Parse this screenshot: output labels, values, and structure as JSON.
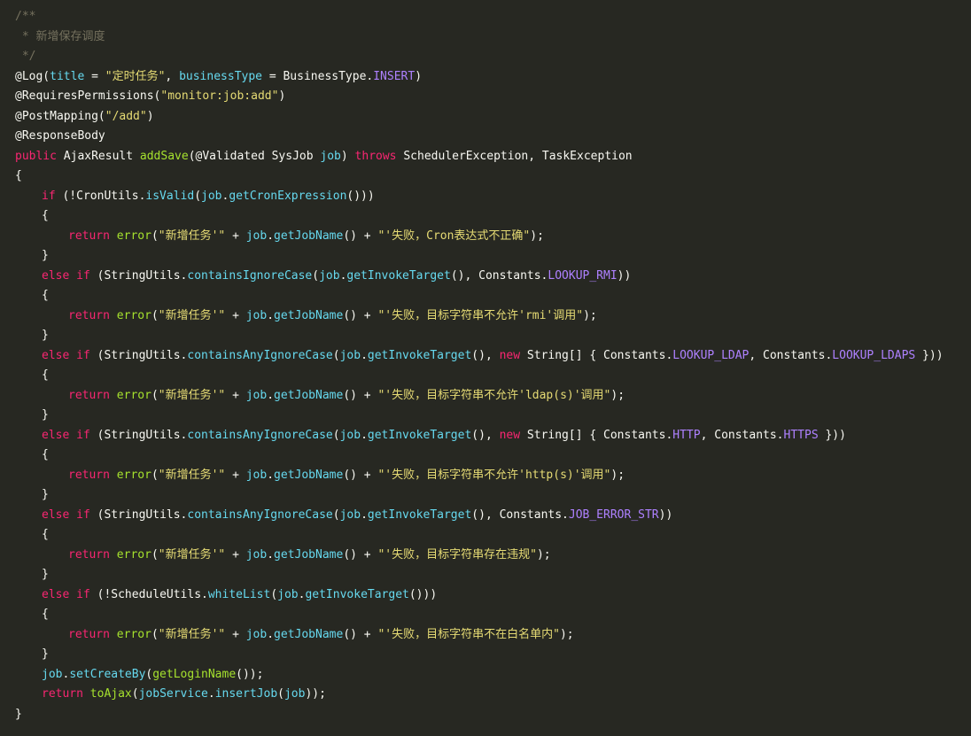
{
  "editor": {
    "theme": {
      "background": "#272822",
      "plain": "#f8f8f2",
      "comment": "#75715e",
      "keyword": "#f92672",
      "string": "#e6db74",
      "function": "#a6e22e",
      "method": "#66d9ef",
      "variable": "#66d9ef",
      "constant": "#ae81ff"
    },
    "lines": [
      {
        "indent": 0,
        "tokens": [
          {
            "t": "c",
            "v": "/**"
          }
        ]
      },
      {
        "indent": 0,
        "tokens": [
          {
            "t": "c",
            "v": " * 新增保存调度"
          }
        ]
      },
      {
        "indent": 0,
        "tokens": [
          {
            "t": "c",
            "v": " */"
          }
        ]
      },
      {
        "indent": 0,
        "tokens": [
          {
            "t": "p",
            "v": "@Log("
          },
          {
            "t": "v",
            "v": "title"
          },
          {
            "t": "p",
            "v": " = "
          },
          {
            "t": "s",
            "v": "\"定时任务\""
          },
          {
            "t": "p",
            "v": ", "
          },
          {
            "t": "v",
            "v": "businessType"
          },
          {
            "t": "p",
            "v": " = BusinessType."
          },
          {
            "t": "cn",
            "v": "INSERT"
          },
          {
            "t": "p",
            "v": ")"
          }
        ]
      },
      {
        "indent": 0,
        "tokens": [
          {
            "t": "p",
            "v": "@RequiresPermissions("
          },
          {
            "t": "s",
            "v": "\"monitor:job:add\""
          },
          {
            "t": "p",
            "v": ")"
          }
        ]
      },
      {
        "indent": 0,
        "tokens": [
          {
            "t": "p",
            "v": "@PostMapping("
          },
          {
            "t": "s",
            "v": "\"/add\""
          },
          {
            "t": "p",
            "v": ")"
          }
        ]
      },
      {
        "indent": 0,
        "tokens": [
          {
            "t": "p",
            "v": "@ResponseBody"
          }
        ]
      },
      {
        "indent": 0,
        "tokens": [
          {
            "t": "k",
            "v": "public"
          },
          {
            "t": "p",
            "v": " AjaxResult "
          },
          {
            "t": "f",
            "v": "addSave"
          },
          {
            "t": "p",
            "v": "(@Validated SysJob "
          },
          {
            "t": "v",
            "v": "job"
          },
          {
            "t": "p",
            "v": ") "
          },
          {
            "t": "k",
            "v": "throws"
          },
          {
            "t": "p",
            "v": " SchedulerException, TaskException"
          }
        ]
      },
      {
        "indent": 0,
        "tokens": [
          {
            "t": "p",
            "v": "{"
          }
        ]
      },
      {
        "indent": 1,
        "tokens": [
          {
            "t": "k",
            "v": "if"
          },
          {
            "t": "p",
            "v": " (!CronUtils."
          },
          {
            "t": "m",
            "v": "isValid"
          },
          {
            "t": "p",
            "v": "("
          },
          {
            "t": "v",
            "v": "job"
          },
          {
            "t": "p",
            "v": "."
          },
          {
            "t": "m",
            "v": "getCronExpression"
          },
          {
            "t": "p",
            "v": "()))"
          }
        ]
      },
      {
        "indent": 1,
        "tokens": [
          {
            "t": "p",
            "v": "{"
          }
        ]
      },
      {
        "indent": 2,
        "tokens": [
          {
            "t": "k",
            "v": "return"
          },
          {
            "t": "p",
            "v": " "
          },
          {
            "t": "f",
            "v": "error"
          },
          {
            "t": "p",
            "v": "("
          },
          {
            "t": "s",
            "v": "\"新增任务'\""
          },
          {
            "t": "p",
            "v": " + "
          },
          {
            "t": "v",
            "v": "job"
          },
          {
            "t": "p",
            "v": "."
          },
          {
            "t": "m",
            "v": "getJobName"
          },
          {
            "t": "p",
            "v": "() + "
          },
          {
            "t": "s",
            "v": "\"'失败，Cron表达式不正确\""
          },
          {
            "t": "p",
            "v": ");"
          }
        ]
      },
      {
        "indent": 1,
        "tokens": [
          {
            "t": "p",
            "v": "}"
          }
        ]
      },
      {
        "indent": 1,
        "tokens": [
          {
            "t": "k",
            "v": "else if"
          },
          {
            "t": "p",
            "v": " (StringUtils."
          },
          {
            "t": "m",
            "v": "containsIgnoreCase"
          },
          {
            "t": "p",
            "v": "("
          },
          {
            "t": "v",
            "v": "job"
          },
          {
            "t": "p",
            "v": "."
          },
          {
            "t": "m",
            "v": "getInvokeTarget"
          },
          {
            "t": "p",
            "v": "(), Constants."
          },
          {
            "t": "cn",
            "v": "LOOKUP_RMI"
          },
          {
            "t": "p",
            "v": "))"
          }
        ]
      },
      {
        "indent": 1,
        "tokens": [
          {
            "t": "p",
            "v": "{"
          }
        ]
      },
      {
        "indent": 2,
        "tokens": [
          {
            "t": "k",
            "v": "return"
          },
          {
            "t": "p",
            "v": " "
          },
          {
            "t": "f",
            "v": "error"
          },
          {
            "t": "p",
            "v": "("
          },
          {
            "t": "s",
            "v": "\"新增任务'\""
          },
          {
            "t": "p",
            "v": " + "
          },
          {
            "t": "v",
            "v": "job"
          },
          {
            "t": "p",
            "v": "."
          },
          {
            "t": "m",
            "v": "getJobName"
          },
          {
            "t": "p",
            "v": "() + "
          },
          {
            "t": "s",
            "v": "\"'失败，目标字符串不允许'rmi'调用\""
          },
          {
            "t": "p",
            "v": ");"
          }
        ]
      },
      {
        "indent": 1,
        "tokens": [
          {
            "t": "p",
            "v": "}"
          }
        ]
      },
      {
        "indent": 1,
        "tokens": [
          {
            "t": "k",
            "v": "else if"
          },
          {
            "t": "p",
            "v": " (StringUtils."
          },
          {
            "t": "m",
            "v": "containsAnyIgnoreCase"
          },
          {
            "t": "p",
            "v": "("
          },
          {
            "t": "v",
            "v": "job"
          },
          {
            "t": "p",
            "v": "."
          },
          {
            "t": "m",
            "v": "getInvokeTarget"
          },
          {
            "t": "p",
            "v": "(), "
          },
          {
            "t": "k",
            "v": "new"
          },
          {
            "t": "p",
            "v": " String[] { Constants."
          },
          {
            "t": "cn",
            "v": "LOOKUP_LDAP"
          },
          {
            "t": "p",
            "v": ", Constants."
          },
          {
            "t": "cn",
            "v": "LOOKUP_LDAPS"
          },
          {
            "t": "p",
            "v": " }))"
          }
        ]
      },
      {
        "indent": 1,
        "tokens": [
          {
            "t": "p",
            "v": "{"
          }
        ]
      },
      {
        "indent": 2,
        "tokens": [
          {
            "t": "k",
            "v": "return"
          },
          {
            "t": "p",
            "v": " "
          },
          {
            "t": "f",
            "v": "error"
          },
          {
            "t": "p",
            "v": "("
          },
          {
            "t": "s",
            "v": "\"新增任务'\""
          },
          {
            "t": "p",
            "v": " + "
          },
          {
            "t": "v",
            "v": "job"
          },
          {
            "t": "p",
            "v": "."
          },
          {
            "t": "m",
            "v": "getJobName"
          },
          {
            "t": "p",
            "v": "() + "
          },
          {
            "t": "s",
            "v": "\"'失败，目标字符串不允许'ldap(s)'调用\""
          },
          {
            "t": "p",
            "v": ");"
          }
        ]
      },
      {
        "indent": 1,
        "tokens": [
          {
            "t": "p",
            "v": "}"
          }
        ]
      },
      {
        "indent": 1,
        "tokens": [
          {
            "t": "k",
            "v": "else if"
          },
          {
            "t": "p",
            "v": " (StringUtils."
          },
          {
            "t": "m",
            "v": "containsAnyIgnoreCase"
          },
          {
            "t": "p",
            "v": "("
          },
          {
            "t": "v",
            "v": "job"
          },
          {
            "t": "p",
            "v": "."
          },
          {
            "t": "m",
            "v": "getInvokeTarget"
          },
          {
            "t": "p",
            "v": "(), "
          },
          {
            "t": "k",
            "v": "new"
          },
          {
            "t": "p",
            "v": " String[] { Constants."
          },
          {
            "t": "cn",
            "v": "HTTP"
          },
          {
            "t": "p",
            "v": ", Constants."
          },
          {
            "t": "cn",
            "v": "HTTPS"
          },
          {
            "t": "p",
            "v": " }))"
          }
        ]
      },
      {
        "indent": 1,
        "tokens": [
          {
            "t": "p",
            "v": "{"
          }
        ]
      },
      {
        "indent": 2,
        "tokens": [
          {
            "t": "k",
            "v": "return"
          },
          {
            "t": "p",
            "v": " "
          },
          {
            "t": "f",
            "v": "error"
          },
          {
            "t": "p",
            "v": "("
          },
          {
            "t": "s",
            "v": "\"新增任务'\""
          },
          {
            "t": "p",
            "v": " + "
          },
          {
            "t": "v",
            "v": "job"
          },
          {
            "t": "p",
            "v": "."
          },
          {
            "t": "m",
            "v": "getJobName"
          },
          {
            "t": "p",
            "v": "() + "
          },
          {
            "t": "s",
            "v": "\"'失败，目标字符串不允许'http(s)'调用\""
          },
          {
            "t": "p",
            "v": ");"
          }
        ]
      },
      {
        "indent": 1,
        "tokens": [
          {
            "t": "p",
            "v": "}"
          }
        ]
      },
      {
        "indent": 1,
        "tokens": [
          {
            "t": "k",
            "v": "else if"
          },
          {
            "t": "p",
            "v": " (StringUtils."
          },
          {
            "t": "m",
            "v": "containsAnyIgnoreCase"
          },
          {
            "t": "p",
            "v": "("
          },
          {
            "t": "v",
            "v": "job"
          },
          {
            "t": "p",
            "v": "."
          },
          {
            "t": "m",
            "v": "getInvokeTarget"
          },
          {
            "t": "p",
            "v": "(), Constants."
          },
          {
            "t": "cn",
            "v": "JOB_ERROR_STR"
          },
          {
            "t": "p",
            "v": "))"
          }
        ]
      },
      {
        "indent": 1,
        "tokens": [
          {
            "t": "p",
            "v": "{"
          }
        ]
      },
      {
        "indent": 2,
        "tokens": [
          {
            "t": "k",
            "v": "return"
          },
          {
            "t": "p",
            "v": " "
          },
          {
            "t": "f",
            "v": "error"
          },
          {
            "t": "p",
            "v": "("
          },
          {
            "t": "s",
            "v": "\"新增任务'\""
          },
          {
            "t": "p",
            "v": " + "
          },
          {
            "t": "v",
            "v": "job"
          },
          {
            "t": "p",
            "v": "."
          },
          {
            "t": "m",
            "v": "getJobName"
          },
          {
            "t": "p",
            "v": "() + "
          },
          {
            "t": "s",
            "v": "\"'失败，目标字符串存在违规\""
          },
          {
            "t": "p",
            "v": ");"
          }
        ]
      },
      {
        "indent": 1,
        "tokens": [
          {
            "t": "p",
            "v": "}"
          }
        ]
      },
      {
        "indent": 1,
        "tokens": [
          {
            "t": "k",
            "v": "else if"
          },
          {
            "t": "p",
            "v": " (!ScheduleUtils."
          },
          {
            "t": "m",
            "v": "whiteList"
          },
          {
            "t": "p",
            "v": "("
          },
          {
            "t": "v",
            "v": "job"
          },
          {
            "t": "p",
            "v": "."
          },
          {
            "t": "m",
            "v": "getInvokeTarget"
          },
          {
            "t": "p",
            "v": "()))"
          }
        ]
      },
      {
        "indent": 1,
        "tokens": [
          {
            "t": "p",
            "v": "{"
          }
        ]
      },
      {
        "indent": 2,
        "tokens": [
          {
            "t": "k",
            "v": "return"
          },
          {
            "t": "p",
            "v": " "
          },
          {
            "t": "f",
            "v": "error"
          },
          {
            "t": "p",
            "v": "("
          },
          {
            "t": "s",
            "v": "\"新增任务'\""
          },
          {
            "t": "p",
            "v": " + "
          },
          {
            "t": "v",
            "v": "job"
          },
          {
            "t": "p",
            "v": "."
          },
          {
            "t": "m",
            "v": "getJobName"
          },
          {
            "t": "p",
            "v": "() + "
          },
          {
            "t": "s",
            "v": "\"'失败，目标字符串不在白名单内\""
          },
          {
            "t": "p",
            "v": ");"
          }
        ]
      },
      {
        "indent": 1,
        "tokens": [
          {
            "t": "p",
            "v": "}"
          }
        ]
      },
      {
        "indent": 1,
        "tokens": [
          {
            "t": "v",
            "v": "job"
          },
          {
            "t": "p",
            "v": "."
          },
          {
            "t": "m",
            "v": "setCreateBy"
          },
          {
            "t": "p",
            "v": "("
          },
          {
            "t": "f",
            "v": "getLoginName"
          },
          {
            "t": "p",
            "v": "());"
          }
        ]
      },
      {
        "indent": 1,
        "tokens": [
          {
            "t": "k",
            "v": "return"
          },
          {
            "t": "p",
            "v": " "
          },
          {
            "t": "f",
            "v": "toAjax"
          },
          {
            "t": "p",
            "v": "("
          },
          {
            "t": "v",
            "v": "jobService"
          },
          {
            "t": "p",
            "v": "."
          },
          {
            "t": "m",
            "v": "insertJob"
          },
          {
            "t": "p",
            "v": "("
          },
          {
            "t": "v",
            "v": "job"
          },
          {
            "t": "p",
            "v": "));"
          }
        ]
      },
      {
        "indent": 0,
        "tokens": [
          {
            "t": "p",
            "v": "}"
          }
        ]
      }
    ]
  }
}
